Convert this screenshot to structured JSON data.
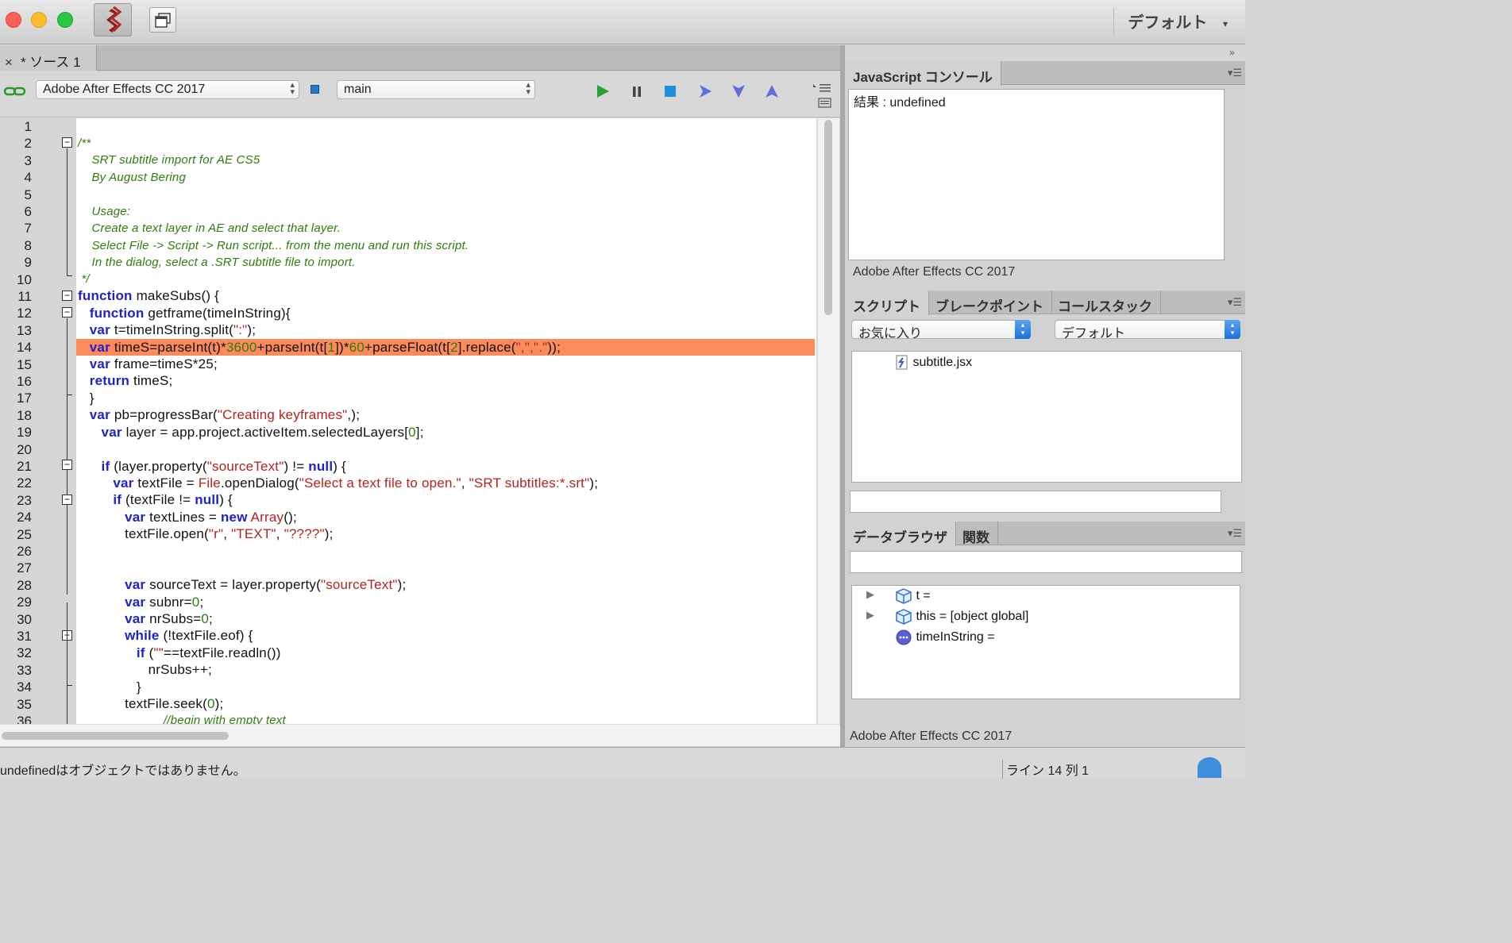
{
  "toolbar": {
    "workspace_label": "デフォルト",
    "workspace_chevron": "▾"
  },
  "document": {
    "tab_close": "×",
    "tab_label": "* ソース 1"
  },
  "editor_toolbar": {
    "target_app": "Adobe After Effects CC 2017",
    "engine": "main",
    "icons": [
      "link-icon",
      "run-icon",
      "pause-icon",
      "stop-icon",
      "step-over-icon",
      "step-into-icon",
      "step-out-icon"
    ]
  },
  "code": {
    "line_numbers": [
      "1",
      "2",
      "3",
      "4",
      "5",
      "6",
      "7",
      "8",
      "9",
      "10",
      "11",
      "12",
      "13",
      "14",
      "15",
      "16",
      "17",
      "18",
      "19",
      "20",
      "21",
      "22",
      "23",
      "24",
      "25",
      "26",
      "27",
      "28",
      "29",
      "30",
      "31",
      "32",
      "33",
      "34",
      "35",
      "36"
    ],
    "comment_lines": [
      "/**",
      "    SRT subtitle import for AE CS5",
      "    By August Bering",
      "    Usage:",
      "    Create a text layer in AE and select that layer.",
      "    Select File -> Script -> Run script... from the menu and run this script.",
      "    In the dialog, select a .SRT subtitle file to import.",
      " */",
      "//begin with empty text"
    ],
    "tokens": {
      "function": "function",
      "var": "var",
      "return": "return",
      "if": "if",
      "while": "while",
      "new": "new",
      "null": "null"
    },
    "lines": {
      "l11": " makeSubs() {",
      "l12": " getframe(timeInString){",
      "l13a": " t=timeInString.split(",
      "l13s": "\":\"",
      "l13b": ");",
      "l14a": " timeS=parseInt(t)*",
      "l14n1": "3600",
      "l14b": "+parseInt(t[",
      "l14n2": "1",
      "l14c": "])*",
      "l14n3": "60",
      "l14d": "+parseFloat(t[",
      "l14n4": "2",
      "l14e": "].replace(",
      "l14s": "\",\",\".\"",
      "l14f": "));",
      "l15": " frame=timeS*25;",
      "l16": " timeS;",
      "l17": "}",
      "l18a": " pb=progressBar(",
      "l18s": "\"Creating keyframes\"",
      "l18b": ",);",
      "l19a": " layer = app.project.activeItem.selectedLayers[",
      "l19n": "0",
      "l19b": "];",
      "l21a": " (layer.property(",
      "l21s": "\"sourceText\"",
      "l21b": ") != ",
      "l21c": ") {",
      "l22a": " textFile = ",
      "l22o": "File",
      "l22b": ".openDialog(",
      "l22s1": "\"Select a text file to open.\"",
      "l22c": ", ",
      "l22s2": "\"SRT subtitles:*.srt\"",
      "l22d": ");",
      "l23a": " (textFile != ",
      "l23b": ") {",
      "l24a": " textLines = ",
      "l24o": "Array",
      "l24b": "();",
      "l25a": "textFile.open(",
      "l25s1": "\"r\"",
      "l25c": ", ",
      "l25s2": "\"TEXT\"",
      "l25s3": "\"????\"",
      "l25b": ");",
      "l28a": " sourceText = layer.property(",
      "l28s": "\"sourceText\"",
      "l28b": ");",
      "l29a": " subnr=",
      "l29n": "0",
      "l29b": ";",
      "l30a": " nrSubs=",
      "l30n": "0",
      "l30b": ";",
      "l31": " (!textFile.eof) {",
      "l32a": " (",
      "l32s": "\"\"",
      "l32b": "==textFile.readln())",
      "l33": "nrSubs++;",
      "l34": "}",
      "l35a": "textFile.seek(",
      "l35n": "0",
      "l35b": ");"
    }
  },
  "console": {
    "tab_label": "JavaScript コンソール",
    "output": "結果 : undefined",
    "footer": "Adobe After Effects CC 2017"
  },
  "scripts": {
    "tabs": [
      "スクリプト",
      "ブレークポイント",
      "コールスタック"
    ],
    "filter_left": "お気に入り",
    "filter_right": "デフォルト",
    "items": [
      "subtitle.jsx"
    ]
  },
  "data_browser": {
    "tabs": [
      "データブラウザ",
      "関数"
    ],
    "rows": [
      {
        "label": "t =",
        "icon": "object-cube-icon"
      },
      {
        "label": "this = [object global]",
        "icon": "object-cube-icon"
      },
      {
        "label": "timeInString =",
        "icon": "undefined-value-icon"
      }
    ],
    "footer": "Adobe After Effects CC 2017"
  },
  "status": {
    "message": "undefinedはオブジェクトではありません。",
    "position": "ライン 14    列 1"
  },
  "colors": {
    "highlight_line": "#fc8b5c",
    "keyword": "#1f22c8",
    "string": "#b2241e",
    "comment": "#2e7d0c",
    "accent_blue": "#2a78c9"
  }
}
